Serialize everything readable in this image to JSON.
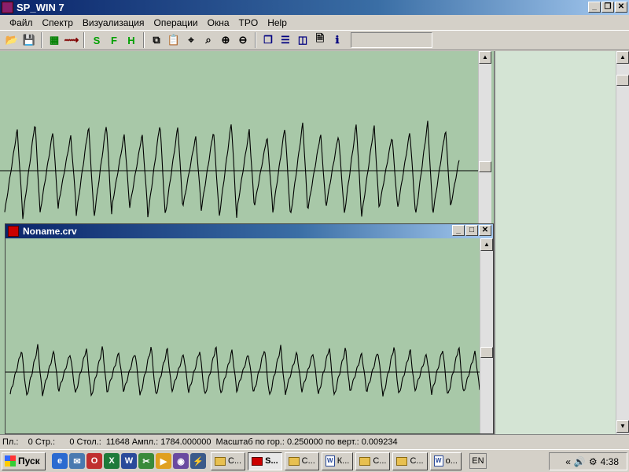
{
  "window": {
    "title": "SP_WIN 7",
    "buttons": {
      "minimize": "_",
      "restore": "❐",
      "close": "✕"
    }
  },
  "menu": [
    "Файл",
    "Спектр",
    "Визуализация",
    "Операции",
    "Окна",
    "TPO",
    "Help"
  ],
  "toolbar": {
    "buttons": [
      {
        "name": "open-icon",
        "glyph": "📂"
      },
      {
        "name": "save-icon",
        "glyph": "💾"
      },
      {
        "name": "sep"
      },
      {
        "name": "spectrum-icon",
        "glyph": "▦",
        "color": "#008000"
      },
      {
        "name": "curve-icon",
        "glyph": "⟿",
        "color": "#800000"
      },
      {
        "name": "sep"
      },
      {
        "name": "s-mode-icon",
        "glyph": "S",
        "color": "#00a000"
      },
      {
        "name": "f-mode-icon",
        "glyph": "F",
        "color": "#00a000"
      },
      {
        "name": "h-mode-icon",
        "glyph": "H",
        "color": "#00a000"
      },
      {
        "name": "sep"
      },
      {
        "name": "copy-icon",
        "glyph": "⧉"
      },
      {
        "name": "paste-icon",
        "glyph": "📋"
      },
      {
        "name": "zoom-fit-icon",
        "glyph": "⌖"
      },
      {
        "name": "zoom-area-icon",
        "glyph": "⌕"
      },
      {
        "name": "zoom-in-icon",
        "glyph": "⊕"
      },
      {
        "name": "zoom-out-icon",
        "glyph": "⊖"
      },
      {
        "name": "sep"
      },
      {
        "name": "cascade-icon",
        "glyph": "❐",
        "color": "#000080"
      },
      {
        "name": "tile-horizontal-icon",
        "glyph": "☰",
        "color": "#000080"
      },
      {
        "name": "tile-vertical-icon",
        "glyph": "◫",
        "color": "#000080"
      },
      {
        "name": "properties-icon",
        "glyph": "🗎"
      },
      {
        "name": "info-icon",
        "glyph": "ℹ",
        "color": "#000080"
      }
    ]
  },
  "child": {
    "title": "Noname.crv",
    "buttons": {
      "minimize": "_",
      "maximize": "□",
      "close": "✕"
    }
  },
  "status": {
    "text": "Пл.:    0 Стр.:      0 Стол.:  11648 Ампл.: 1784.000000  Масштаб по гор.: 0.250000 по верт.: 0.009234"
  },
  "taskbar": {
    "start": "Пуск",
    "tasks": [
      {
        "label": "С...",
        "icon": "folder",
        "active": false
      },
      {
        "label": "S...",
        "icon": "app",
        "active": true
      },
      {
        "label": "С...",
        "icon": "folder",
        "active": false
      },
      {
        "label": "К...",
        "icon": "word",
        "active": false
      },
      {
        "label": "С...",
        "icon": "folder",
        "active": false
      },
      {
        "label": "С...",
        "icon": "folder",
        "active": false
      },
      {
        "label": "о...",
        "icon": "word",
        "active": false
      }
    ],
    "language": "EN",
    "clock": "4:38"
  },
  "colors": {
    "plot_bg": "#a8c8a8",
    "trace": "#000000"
  }
}
